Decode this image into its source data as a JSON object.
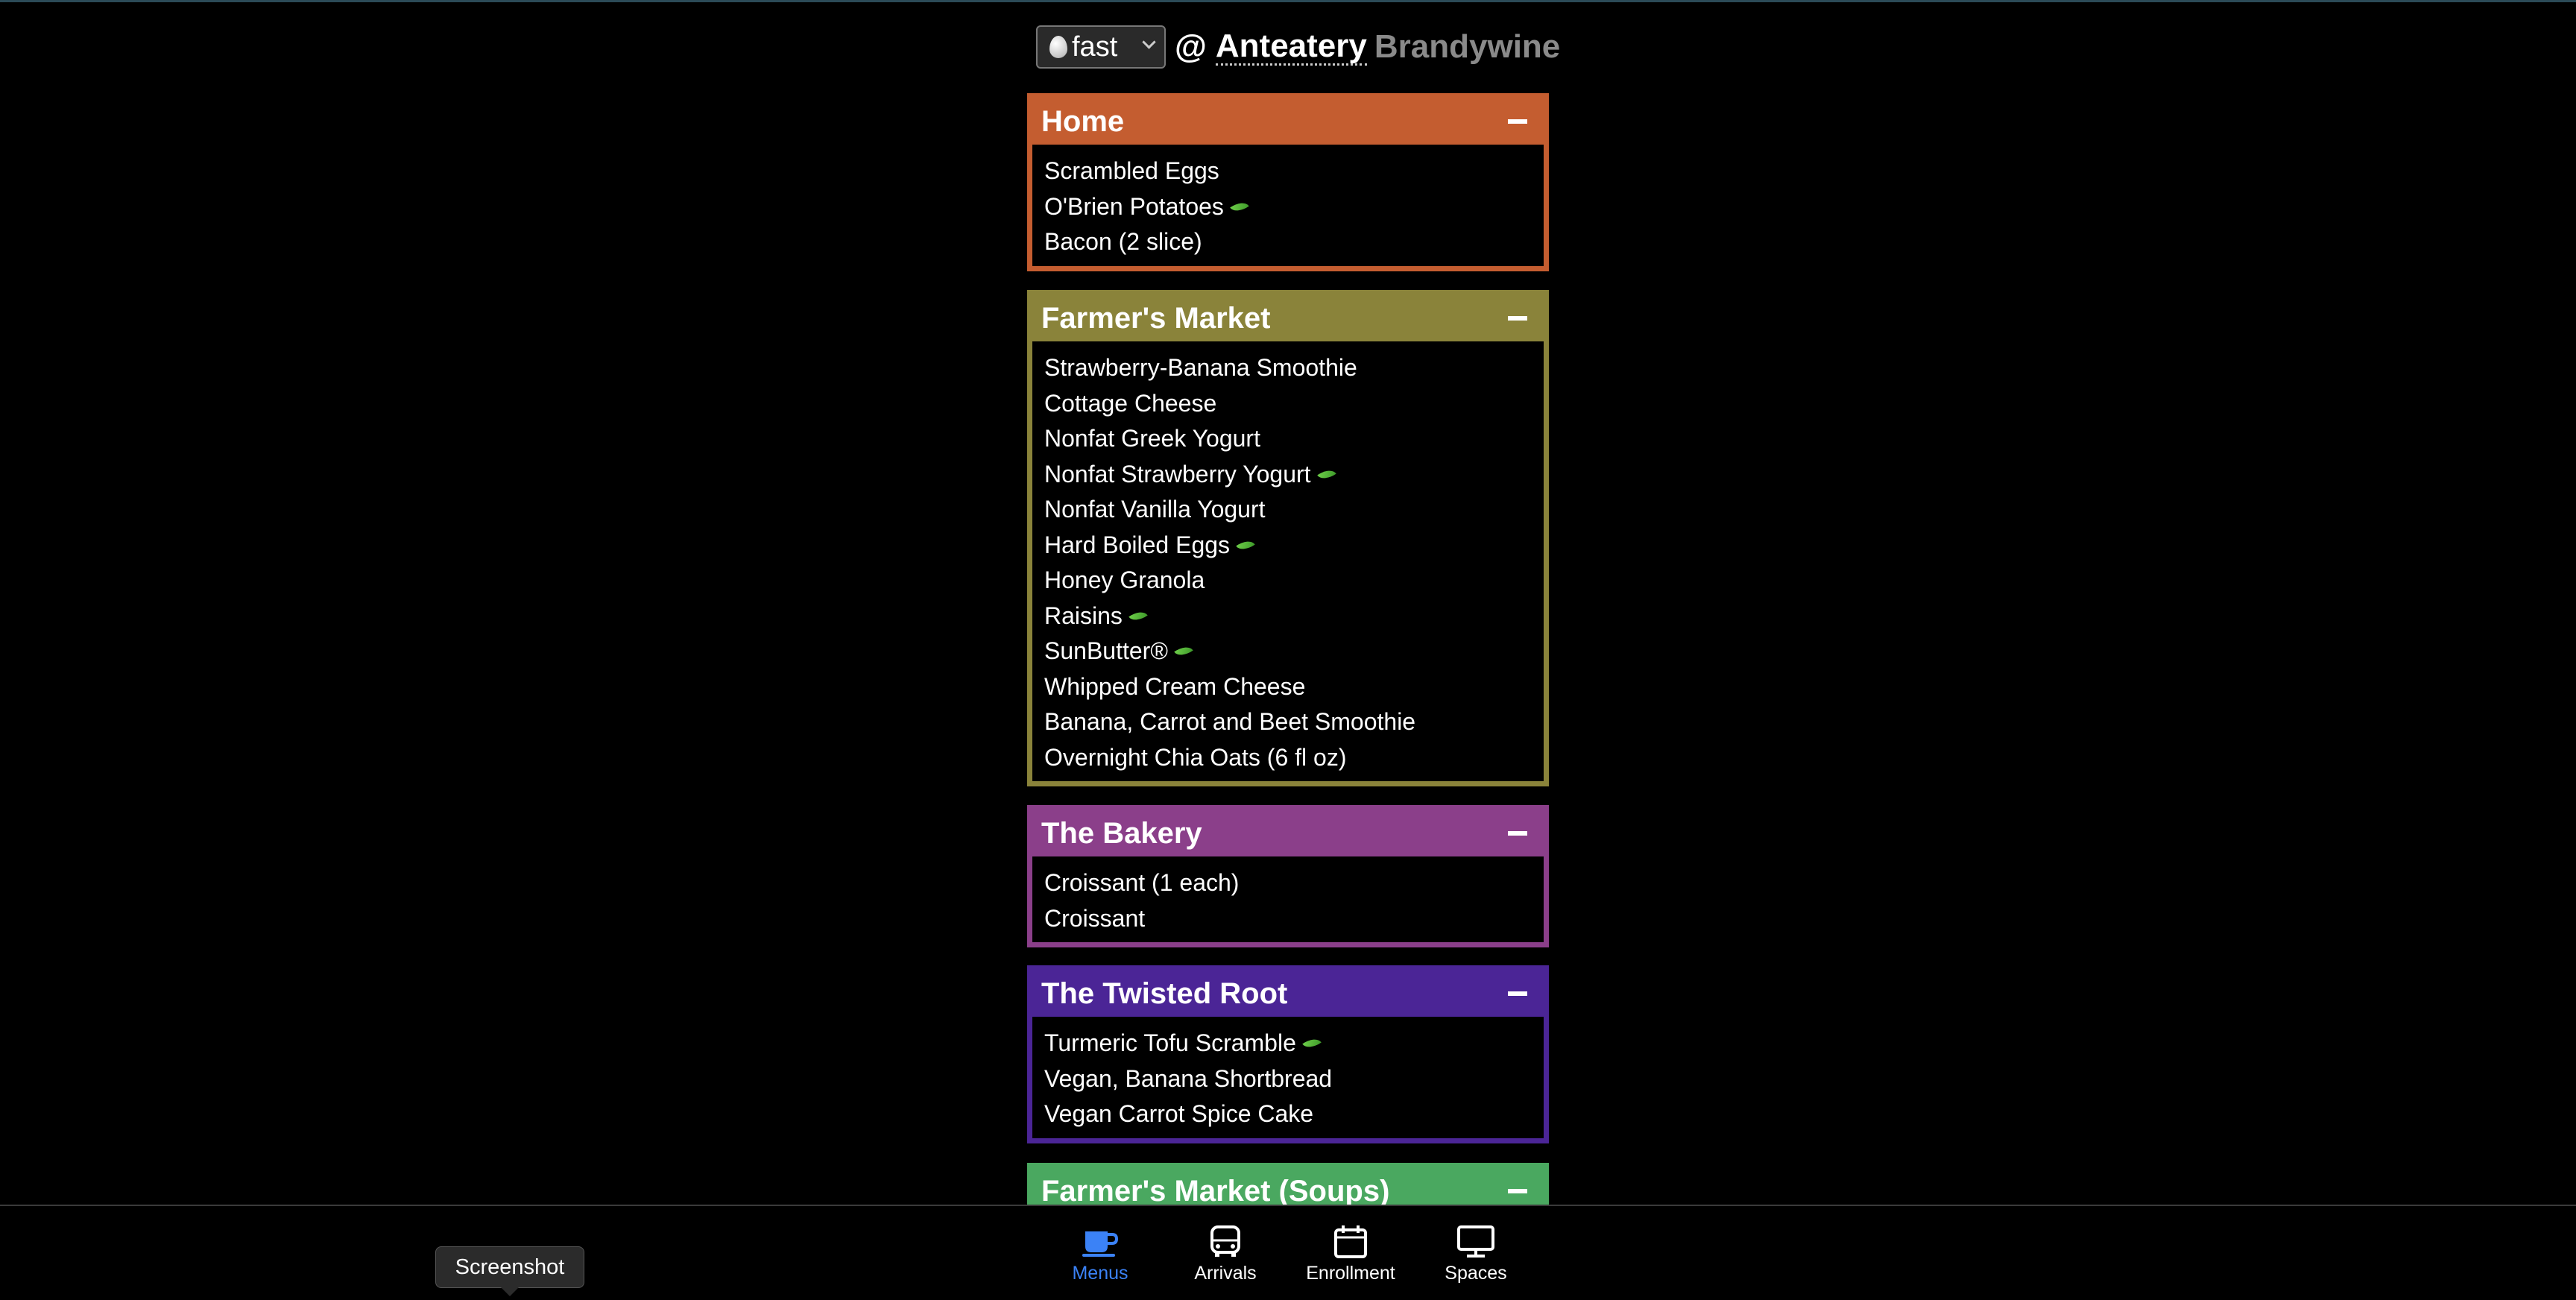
{
  "header": {
    "meal_option": "fast",
    "at_sign": "@",
    "hall_name": "Anteatery",
    "hall_alt": "Brandywine"
  },
  "stations": [
    {
      "name": "Home",
      "color": "#c45d30",
      "items": [
        {
          "name": "Scrambled Eggs",
          "veg": false
        },
        {
          "name": "O'Brien Potatoes",
          "veg": true
        },
        {
          "name": "Bacon (2 slice)",
          "veg": false
        }
      ]
    },
    {
      "name": "Farmer's Market",
      "color": "#8a833a",
      "items": [
        {
          "name": "Strawberry-Banana Smoothie",
          "veg": false
        },
        {
          "name": "Cottage Cheese",
          "veg": false
        },
        {
          "name": "Nonfat Greek Yogurt",
          "veg": false
        },
        {
          "name": "Nonfat Strawberry Yogurt",
          "veg": true
        },
        {
          "name": "Nonfat Vanilla Yogurt",
          "veg": false
        },
        {
          "name": "Hard Boiled Eggs",
          "veg": true
        },
        {
          "name": "Honey Granola",
          "veg": false
        },
        {
          "name": "Raisins",
          "veg": true
        },
        {
          "name": "SunButter®",
          "veg": true
        },
        {
          "name": "Whipped Cream Cheese",
          "veg": false
        },
        {
          "name": "Banana, Carrot and Beet Smoothie",
          "veg": false
        },
        {
          "name": "Overnight Chia Oats (6 fl oz)",
          "veg": false
        }
      ]
    },
    {
      "name": "The Bakery",
      "color": "#8b3f8a",
      "items": [
        {
          "name": "Croissant (1 each)",
          "veg": false
        },
        {
          "name": "Croissant",
          "veg": false
        }
      ]
    },
    {
      "name": "The Twisted Root",
      "color": "#4b2596",
      "items": [
        {
          "name": "Turmeric Tofu Scramble",
          "veg": true
        },
        {
          "name": "Vegan, Banana Shortbread",
          "veg": false
        },
        {
          "name": "Vegan Carrot Spice Cake",
          "veg": false
        }
      ]
    },
    {
      "name": "Farmer's Market (Soups)",
      "color": "#4aa860",
      "items": []
    }
  ],
  "nav": {
    "tabs": [
      {
        "label": "Menus",
        "icon": "coffee-cup-icon",
        "active": true
      },
      {
        "label": "Arrivals",
        "icon": "bus-icon",
        "active": false
      },
      {
        "label": "Enrollment",
        "icon": "calendar-icon",
        "active": false
      },
      {
        "label": "Spaces",
        "icon": "monitor-icon",
        "active": false
      }
    ]
  },
  "tooltip": {
    "text": "Screenshot"
  }
}
